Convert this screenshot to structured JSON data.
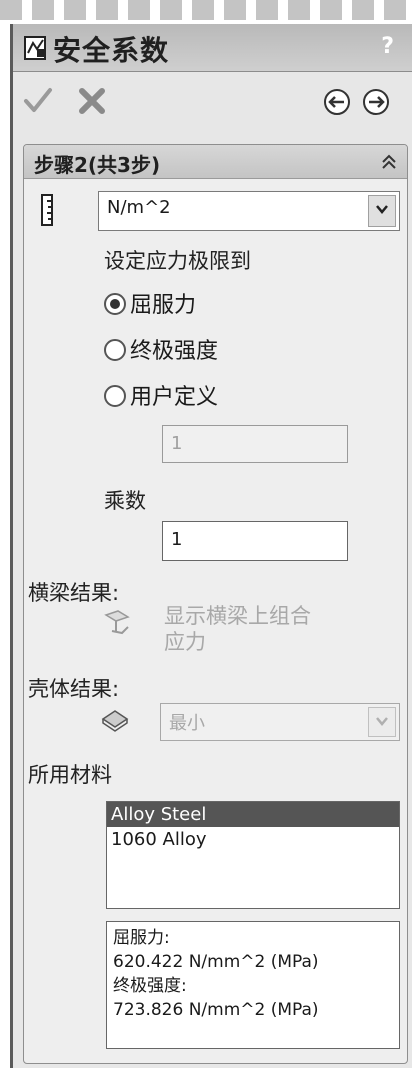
{
  "window": {
    "title": "安全系数",
    "help_label": "?"
  },
  "step": {
    "title": "步骤2(共3步)"
  },
  "units": {
    "selected": "N/m^2"
  },
  "stress_limit": {
    "label": "设定应力极限到",
    "options": [
      "屈服力",
      "终极强度",
      "用户定义"
    ],
    "selected_index": 0,
    "user_value": "1"
  },
  "multiplier": {
    "label": "乘数",
    "value": "1"
  },
  "beam": {
    "label": "横梁结果:",
    "option_line1": "显示横梁上组合",
    "option_line2": "应力"
  },
  "shell": {
    "label": "壳体结果:",
    "selected": "最小"
  },
  "materials": {
    "label": "所用材料",
    "items": [
      "Alloy Steel",
      "1060 Alloy"
    ],
    "selected_index": 0,
    "props": [
      "屈服力:",
      "620.422 N/mm^2 (MPa)",
      "终极强度:",
      "723.826 N/mm^2 (MPa)"
    ]
  }
}
